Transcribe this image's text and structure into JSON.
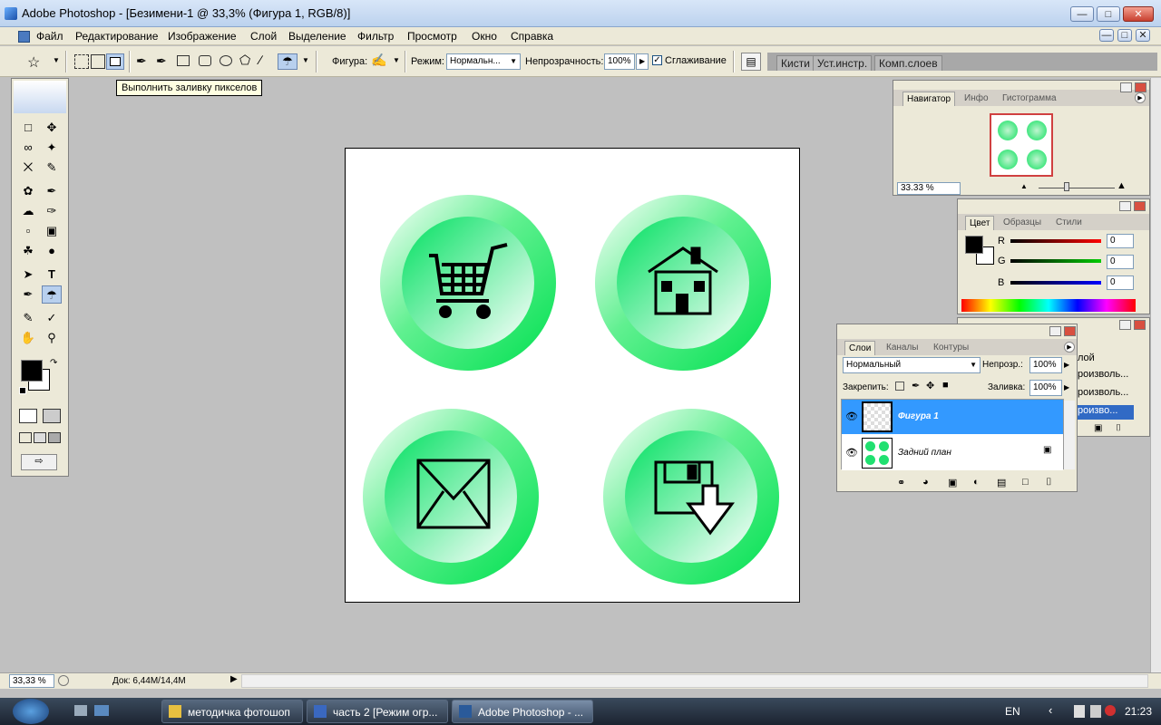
{
  "window": {
    "title": "Adobe Photoshop - [Безимени-1 @ 33,3% (Фигура 1, RGB/8)]"
  },
  "menu": [
    "Файл",
    "Редактирование",
    "Изображение",
    "Слой",
    "Выделение",
    "Фильтр",
    "Просмотр",
    "Окно",
    "Справка"
  ],
  "options": {
    "shape_label": "Фигура:",
    "mode_label": "Режим:",
    "mode_value": "Нормальн...",
    "opacity_label": "Непрозрачность:",
    "opacity_value": "100%",
    "antialias_label": "Сглаживание",
    "antialias_checked": true,
    "well_tabs": [
      "Кисти",
      "Уст.инстр.",
      "Комп.слоев"
    ]
  },
  "tooltip": "Выполнить заливку пикселов",
  "canvas": {
    "button_color": "#00e060",
    "icons": [
      "cart-icon",
      "house-icon",
      "mail-icon",
      "save-icon"
    ]
  },
  "navigator": {
    "tabs": [
      "Навигатор",
      "Инфо",
      "Гистограмма"
    ],
    "zoom": "33.33 %"
  },
  "color_panel": {
    "tabs": [
      "Цвет",
      "Образцы",
      "Стили"
    ],
    "channels": [
      {
        "label": "R",
        "value": "0",
        "color": "#c00000"
      },
      {
        "label": "G",
        "value": "0",
        "color": "#00a000"
      },
      {
        "label": "B",
        "value": "0",
        "color": "#0000c0"
      }
    ]
  },
  "history_panel": {
    "items": [
      "лой",
      "роизволь...",
      "роизволь...",
      "роизво..."
    ]
  },
  "layers_panel": {
    "tabs": [
      "Слои",
      "Каналы",
      "Контуры"
    ],
    "blend_mode": "Нормальный",
    "opacity_label": "Непрозр.:",
    "opacity_value": "100%",
    "lock_label": "Закрепить:",
    "fill_label": "Заливка:",
    "fill_value": "100%",
    "layers": [
      {
        "name": "Фигура 1",
        "selected": true
      },
      {
        "name": "Задний план",
        "selected": false
      }
    ]
  },
  "status": {
    "zoom": "33,33 %",
    "doc": "Док: 6,44M/14,4M"
  },
  "taskbar": {
    "items": [
      {
        "label": "методичка фотошоп",
        "active": false
      },
      {
        "label": "часть 2 [Режим огр...",
        "active": false
      },
      {
        "label": "Adobe Photoshop - ...",
        "active": true
      }
    ],
    "lang": "EN",
    "clock": "21:23"
  }
}
